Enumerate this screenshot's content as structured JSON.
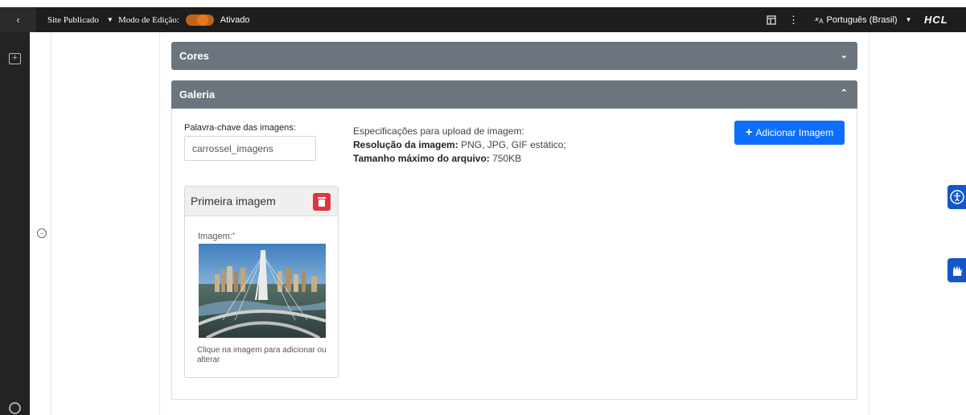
{
  "topbar": {
    "back_icon": "chevron-left-icon",
    "site_label": "Site Publicado",
    "edit_mode_label": "Modo de Edição:",
    "edit_mode_state": "Ativado",
    "language_label": "Português (Brasil)",
    "brand": "HCL",
    "accent_color": "#e87722"
  },
  "leftrail": {
    "icons": [
      "add-panel-icon",
      "collapse-arrow-icon",
      "lifebuoy-icon"
    ]
  },
  "sections": {
    "cores_title": "Cores",
    "galeria_title": "Galeria"
  },
  "galeria": {
    "keyword_label": "Palavra-chave das imagens:",
    "keyword_value": "carrossel_imagens",
    "spec_title": "Especificações para upload de imagem:",
    "resolution_label": "Resolução da imagem:",
    "resolution_value": "PNG, JPG, GIF estático;",
    "max_size_label": "Tamanho máximo do arquivo:",
    "max_size_value": "750KB",
    "add_button": "Adicionar Imagem",
    "card": {
      "title": "Primeira imagem",
      "image_label": "Imagem:",
      "required_mark": "*",
      "hint": "Clique na imagem para adicionar ou alterar"
    }
  },
  "accessibility": {
    "icons": [
      "accessibility-icon",
      "sign-language-icon"
    ]
  },
  "colors": {
    "panel_header": "#6c757d",
    "primary_button": "#0d6efd",
    "danger": "#dc3545"
  }
}
